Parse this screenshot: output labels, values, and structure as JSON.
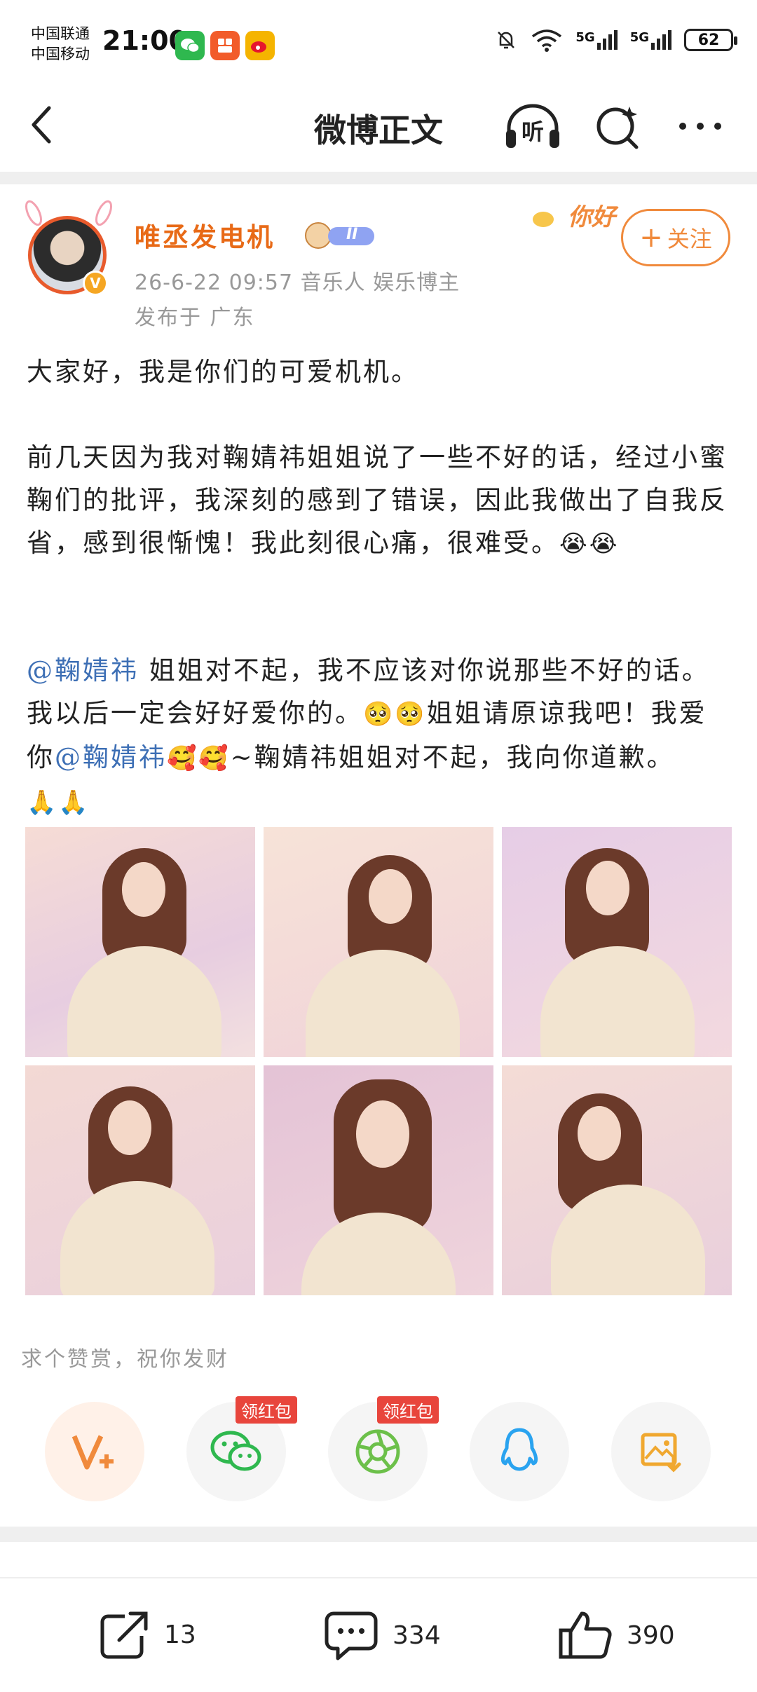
{
  "status_bar": {
    "carrier1": "中国联通",
    "carrier2": "中国移动",
    "time": "21:00",
    "net1": "5G",
    "net2": "5G",
    "battery": "62"
  },
  "nav": {
    "title": "微博正文",
    "listen_label": "听"
  },
  "post": {
    "username": "唯丞发电机",
    "level": "II",
    "meta_line1": "26-6-22 09:57  音乐人 娱乐博主",
    "meta_line2": "发布于 广东",
    "follow_label": "关注",
    "deco_text": "你好",
    "p1": "大家好，我是你们的可爱机机。",
    "p2": "前几天因为我对鞠婧祎姐姐说了一些不好的话，经过小蜜鞠们的批评，我深刻的感到了错误，因此我做出了自我反省，感到很惭愧！我此刻很心痛，很难受。",
    "p2_emoji": "😭😭",
    "mention": "@鞠婧祎",
    "p3a": " 姐姐对不起，我不应该对你说那些不好的话。我以后一定会好好爱你的。",
    "p3_emoji1": "🥺🥺",
    "p3b": "姐姐请原谅我吧！我爱你",
    "p3_emoji2": "🥰🥰",
    "p3c": "~鞠婧祎姐姐对不起，我向你道歉。",
    "p3_emoji3": "🙏🙏"
  },
  "reward": {
    "label": "求个赞赏，祝你发财",
    "red_packet_tag": "领红包"
  },
  "bottom": {
    "repost_count": "13",
    "comment_count": "334",
    "like_count": "390"
  },
  "colors": {
    "accent": "#e86a17",
    "mention": "#3d6fb5",
    "wechat": "#2fb84f",
    "moments": "#6cc04a",
    "qq": "#2aa3ef",
    "tag_red": "#e8453c"
  }
}
